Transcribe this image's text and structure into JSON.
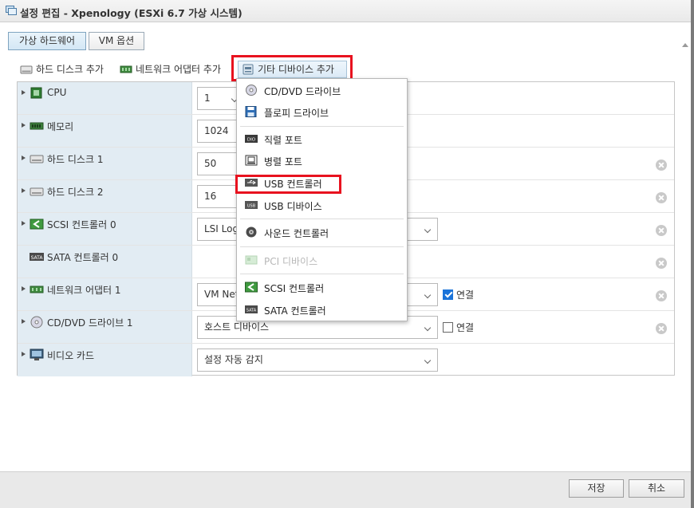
{
  "window": {
    "title": "설정 편집 - Xpenology (ESXi 6.7 가상 시스템)"
  },
  "tabs": [
    {
      "label": "가상 하드웨어",
      "active": true
    },
    {
      "label": "VM 옵션",
      "active": false
    }
  ],
  "add_toolbar": {
    "add_disk": "하드 디스크 추가",
    "add_network": "네트워크 어댑터 추가",
    "add_other": "기타 디바이스 추가"
  },
  "hardware_rows": [
    {
      "label": "CPU",
      "icon": "cpu-icon",
      "value": "1",
      "control": "select",
      "removable": false
    },
    {
      "label": "메모리",
      "icon": "memory-icon",
      "value": "1024",
      "control": "input",
      "removable": false
    },
    {
      "label": "하드 디스크 1",
      "icon": "hard-disk-icon",
      "value": "50",
      "control": "input",
      "removable": true
    },
    {
      "label": "하드 디스크 2",
      "icon": "hard-disk-icon",
      "value": "16",
      "control": "input",
      "removable": true
    },
    {
      "label": "SCSI 컨트롤러 0",
      "icon": "scsi-controller-icon",
      "value": "LSI Log",
      "control": "select",
      "removable": true
    },
    {
      "label": "SATA 컨트롤러 0",
      "icon": "sata-controller-icon",
      "value": "",
      "control": "none",
      "removable": true
    },
    {
      "label": "네트워크 어댑터 1",
      "icon": "network-adapter-icon",
      "value": "VM Net",
      "control": "select",
      "connect_label": "연결",
      "connected": true,
      "removable": true
    },
    {
      "label": "CD/DVD 드라이브 1",
      "icon": "cd-dvd-icon",
      "value": "호스트 디바이스",
      "control": "select",
      "connect_label": "연결",
      "connected": false,
      "removable": true
    },
    {
      "label": "비디오 카드",
      "icon": "video-card-icon",
      "value": "설정 자동 감지",
      "control": "select",
      "removable": false
    }
  ],
  "dropdown_menu": {
    "items": [
      {
        "label": "CD/DVD 드라이브",
        "icon": "cd-dvd-icon",
        "enabled": true
      },
      {
        "label": "플로피 드라이브",
        "icon": "floppy-icon",
        "enabled": true
      },
      {
        "label": "직렬 포트",
        "icon": "serial-port-icon",
        "enabled": true
      },
      {
        "label": "병렬 포트",
        "icon": "parallel-port-icon",
        "enabled": true
      },
      {
        "label": "USB 컨트롤러",
        "icon": "usb-controller-icon",
        "enabled": true,
        "highlighted": true
      },
      {
        "label": "USB 디바이스",
        "icon": "usb-device-icon",
        "enabled": true
      },
      {
        "label": "사운드 컨트롤러",
        "icon": "sound-controller-icon",
        "enabled": true
      },
      {
        "label": "PCI 디바이스",
        "icon": "pci-device-icon",
        "enabled": false
      },
      {
        "label": "SCSI 컨트롤러",
        "icon": "scsi-controller-icon",
        "enabled": true
      },
      {
        "label": "SATA 컨트롤러",
        "icon": "sata-controller-icon",
        "enabled": true
      }
    ]
  },
  "footer": {
    "save_label": "저장",
    "cancel_label": "취소"
  },
  "colors": {
    "highlight_red": "#e8121f",
    "label_column_bg": "#e2ecf3",
    "active_tab_bg": "#d3e7f5",
    "checkbox_checked": "#1a73d9",
    "footer_bg": "#e9e9e9"
  }
}
